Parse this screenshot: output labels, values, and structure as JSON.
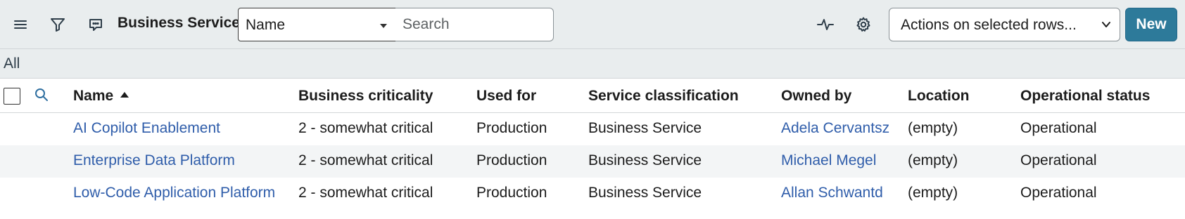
{
  "toolbar": {
    "title": "Business Services",
    "field_select_value": "Name",
    "search_placeholder": "Search",
    "actions_label": "Actions on selected rows...",
    "new_label": "New"
  },
  "filter": {
    "breadcrumb": "All"
  },
  "columns": [
    "Name",
    "Business criticality",
    "Used for",
    "Service classification",
    "Owned by",
    "Location",
    "Operational status"
  ],
  "sort": {
    "column": "Name",
    "direction": "ascending"
  },
  "rows": [
    {
      "name": "AI Copilot Enablement",
      "criticality": "2 - somewhat critical",
      "used_for": "Production",
      "classification": "Business Service",
      "owned_by": "Adela Cervantsz",
      "location": "(empty)",
      "status": "Operational"
    },
    {
      "name": "Enterprise Data Platform",
      "criticality": "2 - somewhat critical",
      "used_for": "Production",
      "classification": "Business Service",
      "owned_by": "Michael Megel",
      "location": "(empty)",
      "status": "Operational"
    },
    {
      "name": "Low-Code Application Platform",
      "criticality": "2 - somewhat critical",
      "used_for": "Production",
      "classification": "Business Service",
      "owned_by": "Allan Schwantd",
      "location": "(empty)",
      "status": "Operational"
    }
  ],
  "icons": [
    "menu-icon",
    "filter-icon",
    "chat-icon",
    "activity-icon",
    "gear-icon",
    "search-icon",
    "chevron-down-icon",
    "sort-ascending-icon"
  ],
  "colors": {
    "toolbar_bg": "#e9edee",
    "primary": "#2d7a9a",
    "link": "#2f5daa",
    "alt_row": "#f3f5f6"
  }
}
